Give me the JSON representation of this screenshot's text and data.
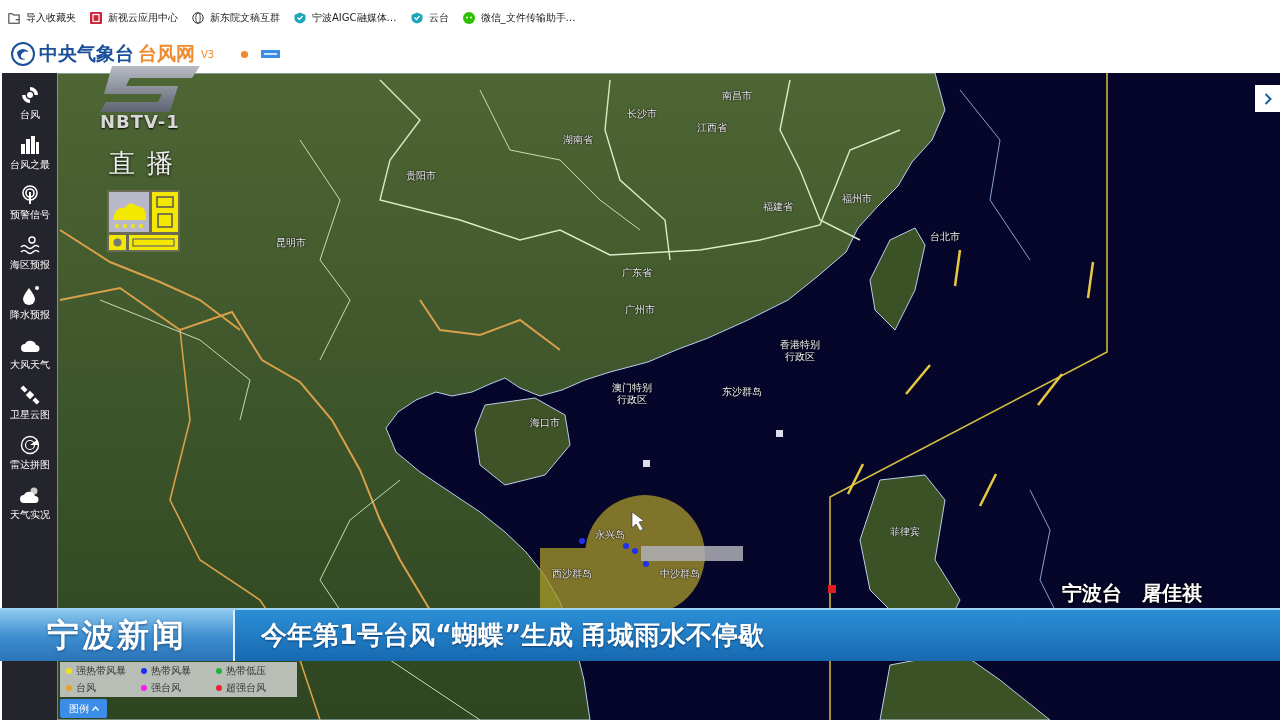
{
  "bookmarks_bar": {
    "items": [
      {
        "label": "导入收藏夹",
        "kind": "folder"
      },
      {
        "label": "新视云应用中心",
        "kind": "app"
      },
      {
        "label": "新东院文稿互群",
        "kind": "globe"
      },
      {
        "label": "宁波AIGC融媒体…",
        "kind": "shield"
      },
      {
        "label": "云台",
        "kind": "shield"
      },
      {
        "label": "微信_文件传输助手…",
        "kind": "chat"
      }
    ]
  },
  "site_header": {
    "title": "中央气象台",
    "title_accent": "台风网",
    "version": "V3"
  },
  "sidebar": {
    "items": [
      {
        "label": "台风",
        "kind": "typhoon"
      },
      {
        "label": "台风之最",
        "kind": "ranking"
      },
      {
        "label": "预警信号",
        "kind": "warning"
      },
      {
        "label": "海区预报",
        "kind": "sea"
      },
      {
        "label": "降水预报",
        "kind": "rain"
      },
      {
        "label": "大风天气",
        "kind": "wind"
      },
      {
        "label": "卫星云图",
        "kind": "satellite"
      },
      {
        "label": "雷达拼图",
        "kind": "radar"
      },
      {
        "label": "天气实况",
        "kind": "observation"
      }
    ]
  },
  "map": {
    "labels": [
      "南昌市",
      "长沙市",
      "江西省",
      "湖南省",
      "贵阳市",
      "福州市",
      "福建省",
      "昆明市",
      "广东省",
      "广州市",
      "台北市",
      "香港特别行政区",
      "澳门特别行政区",
      "东沙群岛",
      "海口市",
      "菲律宾",
      "永兴岛",
      "西沙群岛",
      "中沙群岛"
    ]
  },
  "legend": {
    "items": [
      {
        "label": "强热带风暴",
        "color": "#f0e020"
      },
      {
        "label": "热带风暴",
        "color": "#2030f0"
      },
      {
        "label": "热带低压",
        "color": "#20b040"
      },
      {
        "label": "台风",
        "color": "#f0a020"
      },
      {
        "label": "强台风",
        "color": "#f020f0"
      },
      {
        "label": "超强台风",
        "color": "#f02030"
      }
    ],
    "button": "图例"
  },
  "tv_overlay": {
    "channel": "NBTV-1",
    "live_label": "直播",
    "program": "宁波新闻",
    "headline": "今年第1号台风“蝴蝶”生成 甬城雨水不停歇",
    "reporter": [
      "宁波台",
      "屠佳祺"
    ]
  }
}
